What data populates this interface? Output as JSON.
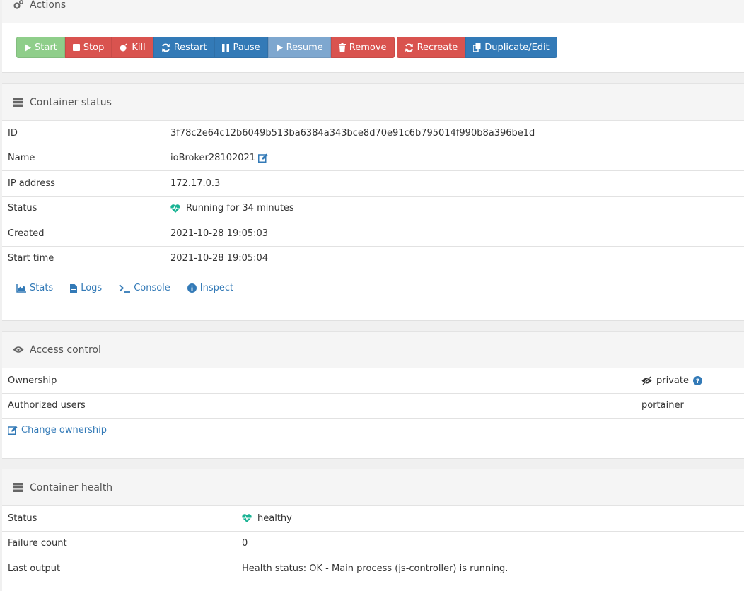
{
  "actions": {
    "title": "Actions",
    "buttons": {
      "start": "Start",
      "stop": "Stop",
      "kill": "Kill",
      "restart": "Restart",
      "pause": "Pause",
      "resume": "Resume",
      "remove": "Remove",
      "recreate": "Recreate",
      "duplicate": "Duplicate/Edit"
    }
  },
  "container_status": {
    "title": "Container status",
    "rows": {
      "id": {
        "label": "ID",
        "value": "3f78c2e64c12b6049b513ba6384a343bce8d70e91c6b795014f990b8a396be1d"
      },
      "name": {
        "label": "Name",
        "value": "ioBroker28102021"
      },
      "ip": {
        "label": "IP address",
        "value": "172.17.0.3"
      },
      "status": {
        "label": "Status",
        "value": "Running for 34 minutes"
      },
      "created": {
        "label": "Created",
        "value": "2021-10-28 19:05:03"
      },
      "start_time": {
        "label": "Start time",
        "value": "2021-10-28 19:05:04"
      }
    },
    "links": {
      "stats": "Stats",
      "logs": "Logs",
      "console": "Console",
      "inspect": "Inspect"
    }
  },
  "access_control": {
    "title": "Access control",
    "ownership_label": "Ownership",
    "ownership_value": "private",
    "authorized_label": "Authorized users",
    "authorized_value": "portainer",
    "change_ownership": "Change ownership"
  },
  "container_health": {
    "title": "Container health",
    "rows": {
      "status": {
        "label": "Status",
        "value": "healthy"
      },
      "failure": {
        "label": "Failure count",
        "value": "0"
      },
      "output": {
        "label": "Last output",
        "value": "Health status: OK - Main process (js-controller) is running."
      }
    }
  },
  "colors": {
    "start": "#8fce8a",
    "danger": "#d9534f",
    "primary": "#337ab7",
    "resume": "#7ea7cf",
    "healthy": "#1ab394"
  }
}
